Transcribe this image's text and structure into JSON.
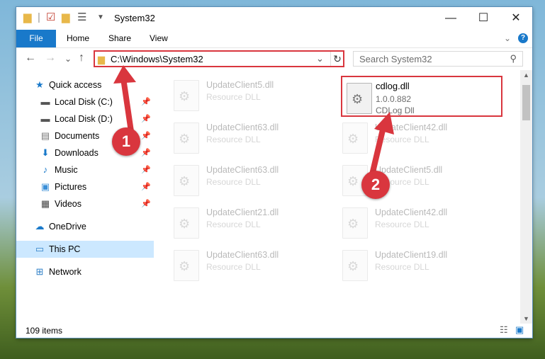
{
  "window": {
    "title": "System32"
  },
  "titlebar": {
    "minimize": "—",
    "maximize": "☐",
    "close": "✕"
  },
  "ribbon": {
    "tabs": [
      "File",
      "Home",
      "Share",
      "View"
    ],
    "collapse": "⌄",
    "help": "?"
  },
  "nav": {
    "back": "←",
    "forward": "→",
    "recent": "⌄",
    "up": "↑",
    "dropdown": "⌄",
    "refresh": "↻"
  },
  "address": {
    "path": "C:\\Windows\\System32"
  },
  "search": {
    "placeholder": "Search System32"
  },
  "sidebar": {
    "items": [
      {
        "label": "Quick access",
        "icon": "star-icon"
      },
      {
        "label": "Local Disk (C:)",
        "icon": "drive-icon"
      },
      {
        "label": "Local Disk (D:)",
        "icon": "drive-icon"
      },
      {
        "label": "Documents",
        "icon": "documents-icon"
      },
      {
        "label": "Downloads",
        "icon": "download-icon"
      },
      {
        "label": "Music",
        "icon": "music-icon"
      },
      {
        "label": "Pictures",
        "icon": "pictures-icon"
      },
      {
        "label": "Videos",
        "icon": "videos-icon"
      },
      {
        "label": "OneDrive",
        "icon": "cloud-icon"
      },
      {
        "label": "This PC",
        "icon": "computer-icon"
      },
      {
        "label": "Network",
        "icon": "network-icon"
      }
    ]
  },
  "files": [
    {
      "name": "UpdateClient5.dll",
      "desc": "Resource DLL"
    },
    {
      "name": "UpdateClient63.dll",
      "desc": "Resource DLL"
    },
    {
      "name": "UpdateClient42.dll",
      "desc": "Resource DLL"
    },
    {
      "name": "UpdateClient63.dll",
      "desc": "Resource DLL"
    },
    {
      "name": "UpdateClient5.dll",
      "desc": "Resource DLL"
    },
    {
      "name": "UpdateClient21.dll",
      "desc": "Resource DLL"
    },
    {
      "name": "UpdateClient42.dll",
      "desc": "Resource DLL"
    },
    {
      "name": "UpdateClient63.dll",
      "desc": "Resource DLL"
    },
    {
      "name": "UpdateClient19.dll",
      "desc": "Resource DLL"
    }
  ],
  "highlighted_file": {
    "name": "cdlog.dll",
    "version": "1.0.0.882",
    "desc": "CDLog Dll"
  },
  "status": {
    "items": "109 items"
  },
  "annotations": {
    "step1": "1",
    "step2": "2"
  },
  "colors": {
    "accent": "#1979ca",
    "highlight": "#d9363e",
    "selection": "#cce8ff"
  }
}
